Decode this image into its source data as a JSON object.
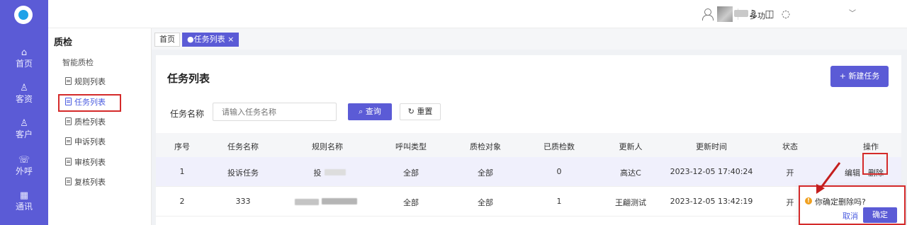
{
  "rail": {
    "items": [
      {
        "label": "首页",
        "icon": "home-icon"
      },
      {
        "label": "客资",
        "icon": "users-icon"
      },
      {
        "label": "客户",
        "icon": "user-icon"
      },
      {
        "label": "外呼",
        "icon": "phone-icon"
      },
      {
        "label": "通讯",
        "icon": "contacts-icon"
      }
    ]
  },
  "topbar": {
    "icons": [
      "headset-icon",
      "book-icon",
      "chat-icon"
    ],
    "user_name": "多功...",
    "accent": "#5b5bd6"
  },
  "subnav": {
    "title": "质检",
    "group": "智能质检",
    "items": [
      {
        "label": "规则列表"
      },
      {
        "label": "任务列表"
      },
      {
        "label": "质检列表"
      },
      {
        "label": "申诉列表"
      },
      {
        "label": "审核列表"
      },
      {
        "label": "复核列表"
      }
    ],
    "active_index": 1
  },
  "tabs": [
    {
      "label": "首页"
    },
    {
      "label": "●任务列表 ×"
    }
  ],
  "main": {
    "title": "任务列表",
    "new_button": "+ 新建任务",
    "filter": {
      "label": "任务名称",
      "placeholder": "请输入任务名称",
      "query_button": "查询",
      "reset_button": "重置"
    },
    "table": {
      "columns": [
        "序号",
        "任务名称",
        "规则名称",
        "呼叫类型",
        "质检对象",
        "已质检数",
        "更新人",
        "更新时间",
        "状态",
        "操作"
      ],
      "rows": [
        {
          "no": "1",
          "task": "投诉任务",
          "rule": "投",
          "call_type": "全部",
          "target": "全部",
          "checked": "0",
          "updater": "高达C",
          "time": "2023-12-05 17:40:24",
          "status": "开"
        },
        {
          "no": "2",
          "task": "333",
          "rule": "",
          "call_type": "全部",
          "target": "全部",
          "checked": "1",
          "updater": "王翩测试",
          "time": "2023-12-05 13:42:19",
          "status": "开"
        }
      ],
      "actions": {
        "edit": "编辑",
        "delete": "删除"
      }
    }
  },
  "popconfirm": {
    "text": "你确定删除吗?",
    "cancel": "取消",
    "confirm": "确定",
    "highlight_color": "#d42a2a"
  }
}
